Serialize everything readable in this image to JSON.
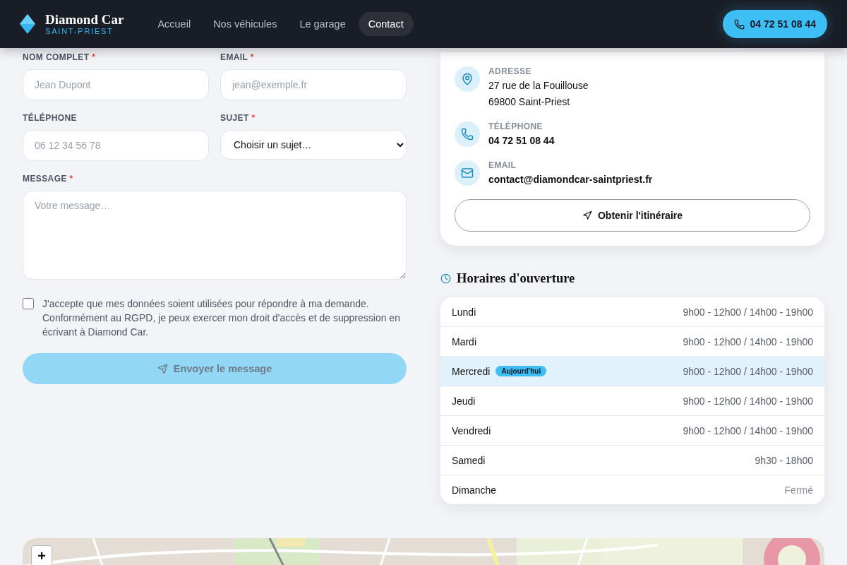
{
  "header": {
    "brand": "Diamond Car",
    "subtitle": "SAINT-PRIEST",
    "nav": [
      {
        "label": "Accueil",
        "selected": false
      },
      {
        "label": "Nos véhicules",
        "selected": false
      },
      {
        "label": "Le garage",
        "selected": false
      },
      {
        "label": "Contact",
        "selected": true
      }
    ],
    "phone_button": "04 72 51 08 44"
  },
  "form": {
    "fields": [
      {
        "kind": "input",
        "label": "NOM COMPLET",
        "required": true,
        "placeholder": "Jean Dupont"
      },
      {
        "kind": "input",
        "label": "EMAIL",
        "required": true,
        "placeholder": "jean@exemple.fr"
      },
      {
        "kind": "input",
        "label": "TÉLÉPHONE",
        "required": false,
        "placeholder": "06 12 34 56 78"
      },
      {
        "kind": "select",
        "label": "SUJET",
        "required": true,
        "value": "Choisir un sujet…"
      },
      {
        "kind": "textarea",
        "label": "MESSAGE",
        "required": true,
        "placeholder": "Votre message…"
      }
    ],
    "required_mark": "*",
    "consent": {
      "checked": false,
      "text": "J'accepte que mes données soient utilisées pour répondre à ma demande. Conformément au RGPD, je peux exercer mon droit d'accès et de suppression en écrivant à Diamond Car."
    },
    "submit": {
      "label": "Envoyer le message",
      "disabled": true
    }
  },
  "contact": {
    "items": [
      {
        "kind": "address",
        "label": "ADRESSE",
        "lines": [
          "27 rue de la Fouillouse",
          "69800 Saint-Priest"
        ]
      },
      {
        "kind": "phone",
        "label": "TÉLÉPHONE",
        "lines": [
          "04 72 51 08 44"
        ]
      },
      {
        "kind": "email",
        "label": "EMAIL",
        "lines": [
          "contact@diamondcar-saintpriest.fr"
        ]
      }
    ],
    "route_button": "Obtenir l'itinéraire"
  },
  "hours": {
    "title": "Horaires d'ouverture",
    "rows": [
      {
        "day": "Lundi",
        "hours": "9h00 - 12h00 / 14h00 - 19h00",
        "today": false,
        "closed": false
      },
      {
        "day": "Mardi",
        "hours": "9h00 - 12h00 / 14h00 - 19h00",
        "today": false,
        "closed": false
      },
      {
        "day": "Mercredi",
        "hours": "9h00 - 12h00 / 14h00 - 19h00",
        "today": true,
        "badge": "Aujourd'hui",
        "closed": false
      },
      {
        "day": "Jeudi",
        "hours": "9h00 - 12h00 / 14h00 - 19h00",
        "today": false,
        "closed": false
      },
      {
        "day": "Vendredi",
        "hours": "9h00 - 12h00 / 14h00 - 19h00",
        "today": false,
        "closed": false
      },
      {
        "day": "Samedi",
        "hours": "9h30 - 18h00",
        "today": false,
        "closed": false
      },
      {
        "day": "Dimanche",
        "hours": "Fermé",
        "today": false,
        "closed": true
      }
    ]
  },
  "map": {
    "kind": "picture",
    "zoom_in": "+"
  }
}
